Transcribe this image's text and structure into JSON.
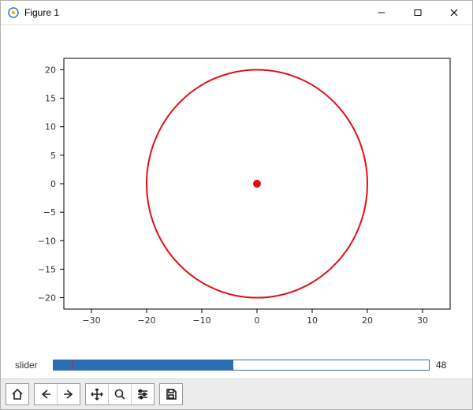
{
  "window": {
    "title": "Figure 1"
  },
  "chart_data": {
    "type": "line",
    "series": [
      {
        "name": "circle",
        "shape": "circle",
        "cx": 0,
        "cy": 0,
        "r": 20,
        "color": "#e01010",
        "linewidth": 2
      },
      {
        "name": "center",
        "shape": "point",
        "x": 0,
        "y": 0,
        "color": "#e01010",
        "size": 5
      }
    ],
    "xlim": [
      -35,
      35
    ],
    "ylim": [
      -22,
      22
    ],
    "xticks": [
      -30,
      -20,
      -10,
      0,
      10,
      20,
      30
    ],
    "yticks": [
      -20,
      -15,
      -10,
      -5,
      0,
      5,
      10,
      15,
      20
    ],
    "xlabel": "",
    "ylabel": "",
    "title": "",
    "grid": false
  },
  "slider": {
    "label": "slider",
    "value": 48,
    "min": 0,
    "max": 100,
    "init": 5
  },
  "toolbar": {
    "home": "Reset original view",
    "back": "Back to previous view",
    "forward": "Forward to next view",
    "pan": "Pan axes",
    "zoom": "Zoom to rectangle",
    "configure": "Configure subplots",
    "save": "Save the figure"
  }
}
